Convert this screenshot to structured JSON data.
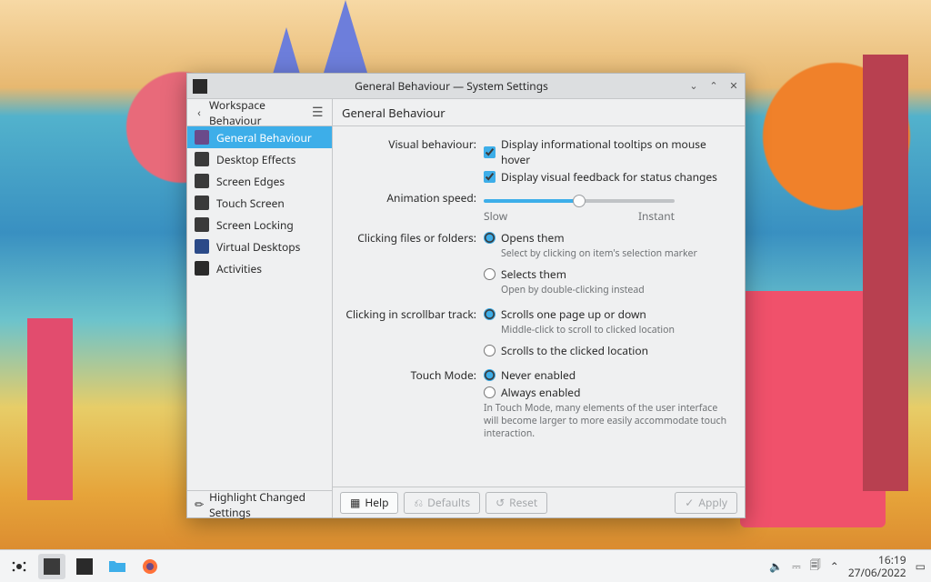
{
  "window": {
    "title": "General Behaviour — System Settings",
    "back_label": "Workspace Behaviour",
    "page_heading": "General Behaviour"
  },
  "sidebar": {
    "items": [
      {
        "label": "General Behaviour",
        "color": "#3daee9"
      },
      {
        "label": "Desktop Effects",
        "color": "#3a3a3a"
      },
      {
        "label": "Screen Edges",
        "color": "#3a3a3a"
      },
      {
        "label": "Touch Screen",
        "color": "#3a3a3a"
      },
      {
        "label": "Screen Locking",
        "color": "#3a3a3a"
      },
      {
        "label": "Virtual Desktops",
        "color": "#2b4a88"
      },
      {
        "label": "Activities",
        "color": "#2a2a2a"
      }
    ],
    "highlight": "Highlight Changed Settings"
  },
  "form": {
    "visual_label": "Visual behaviour:",
    "tooltips": "Display informational tooltips on mouse hover",
    "feedback": "Display visual feedback for status changes",
    "anim_label": "Animation speed:",
    "anim_slow": "Slow",
    "anim_fast": "Instant",
    "anim_value": 50,
    "click_files_label": "Clicking files or folders:",
    "opens": "Opens them",
    "opens_hint": "Select by clicking on item's selection marker",
    "selects": "Selects them",
    "selects_hint": "Open by double-clicking instead",
    "scroll_label": "Clicking in scrollbar track:",
    "scroll_page": "Scrolls one page up or down",
    "scroll_page_hint": "Middle-click to scroll to clicked location",
    "scroll_click": "Scrolls to the clicked location",
    "touch_label": "Touch Mode:",
    "touch_never": "Never enabled",
    "touch_always": "Always enabled",
    "touch_hint": "In Touch Mode, many elements of the user interface will become larger to more easily accommodate touch interaction."
  },
  "footer": {
    "help": "Help",
    "defaults": "Defaults",
    "reset": "Reset",
    "apply": "Apply"
  },
  "taskbar": {
    "time": "16:19",
    "date": "27/06/2022"
  }
}
